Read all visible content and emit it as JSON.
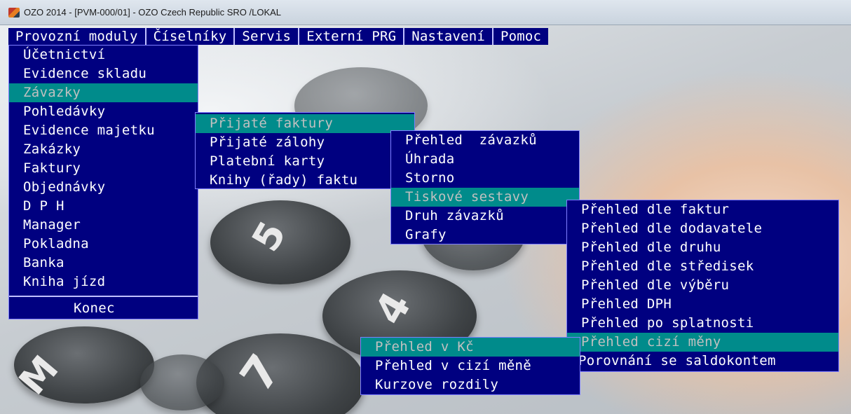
{
  "window": {
    "title": "OZO 2014 - [PVM-000/01] - OZO Czech Republic SRO /LOKAL"
  },
  "menubar": [
    "Provozní moduly",
    "Číselníky",
    "Servis",
    "Externí PRG",
    "Nastavení",
    "Pomoc"
  ],
  "menu_main": {
    "items": [
      "Účetnictví",
      "Evidence skladu",
      "Závazky",
      "Pohledávky",
      "Evidence majetku",
      "Zakázky",
      "Faktury",
      "Objednávky",
      "D P H",
      "Manager",
      "Pokladna",
      "Banka",
      "Kniha jízd"
    ],
    "highlighted": "Závazky",
    "footer": "Konec"
  },
  "menu_zavazky": {
    "items": [
      "Přijaté faktury",
      "Přijaté zálohy",
      "Platební karty",
      "Knihy (řady) faktu"
    ],
    "highlighted": "Přijaté faktury"
  },
  "menu_prijate": {
    "items": [
      "Přehled  závazků",
      "Úhrada",
      "Storno",
      "Tiskové sestavy",
      "Druh závazků",
      "Grafy"
    ],
    "highlighted": "Tiskové sestavy"
  },
  "menu_tiskove": {
    "items": [
      "Přehled dle faktur",
      "Přehled dle dodavatele",
      "Přehled dle druhu",
      "Přehled dle středisek",
      "Přehled dle výběru",
      "Přehled DPH",
      "Přehled po splatnosti",
      "Přehled cizí měny",
      "Porovnání se saldokontem"
    ],
    "highlighted": "Přehled cizí měny"
  },
  "menu_cizi_meny": {
    "items": [
      "Přehled v Kč",
      "Přehled v cizí měně",
      "Kurzove rozdily"
    ],
    "highlighted": "Přehled v Kč"
  },
  "key_glyphs": [
    "5",
    "4",
    "M",
    "7"
  ]
}
